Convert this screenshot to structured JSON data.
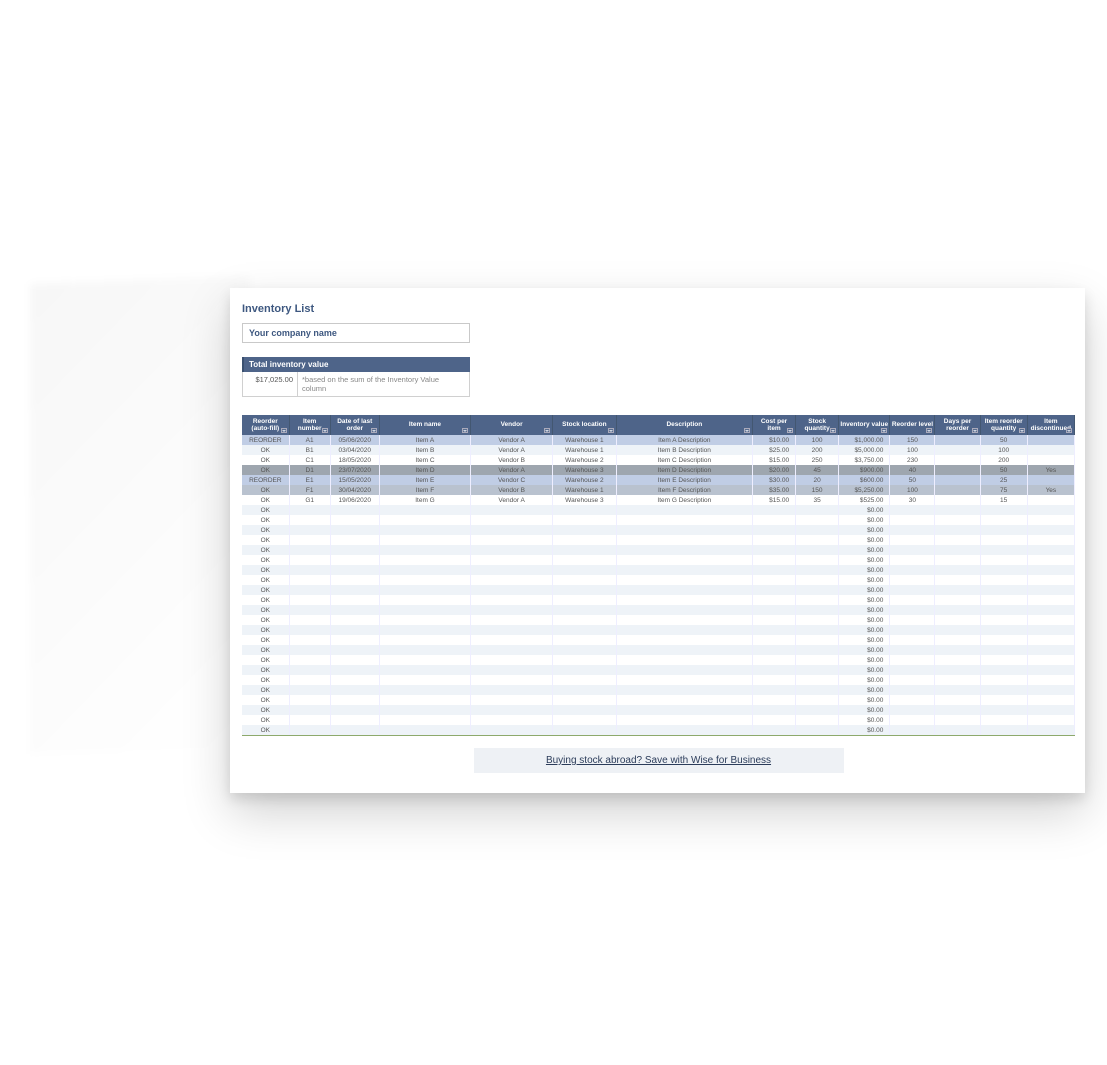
{
  "title": "Inventory List",
  "company_placeholder": "Your company name",
  "tiv_label": "Total inventory value",
  "tiv_value": "$17,025.00",
  "tiv_note": "*based on the sum of the Inventory Value column",
  "headers": {
    "reorder": "Reorder (auto-fill)",
    "item_number": "Item number",
    "date": "Date of last order",
    "name": "Item name",
    "vendor": "Vendor",
    "location": "Stock location",
    "description": "Description",
    "cost": "Cost per item",
    "qty": "Stock quantity",
    "value": "Inventory value",
    "level": "Reorder level",
    "days": "Days per reorder",
    "rqty": "Item reorder quantity",
    "disc": "Item discontinued"
  },
  "rows": [
    {
      "status": "REORDER",
      "item": "A1",
      "date": "05/06/2020",
      "name": "Item A",
      "vendor": "Vendor A",
      "loc": "Warehouse 1",
      "desc": "Item A Description",
      "cost": "$10.00",
      "qty": "100",
      "value": "$1,000.00",
      "level": "150",
      "days": "",
      "rqty": "50",
      "disc": "",
      "cls": "r-reorder"
    },
    {
      "status": "OK",
      "item": "B1",
      "date": "03/04/2020",
      "name": "Item B",
      "vendor": "Vendor A",
      "loc": "Warehouse 1",
      "desc": "Item B Description",
      "cost": "$25.00",
      "qty": "200",
      "value": "$5,000.00",
      "level": "100",
      "days": "",
      "rqty": "100",
      "disc": "",
      "cls": "r-normal"
    },
    {
      "status": "OK",
      "item": "C1",
      "date": "18/05/2020",
      "name": "Item C",
      "vendor": "Vendor B",
      "loc": "Warehouse 2",
      "desc": "Item C Description",
      "cost": "$15.00",
      "qty": "250",
      "value": "$3,750.00",
      "level": "230",
      "days": "",
      "rqty": "200",
      "disc": "",
      "cls": "r-normal2"
    },
    {
      "status": "OK",
      "item": "D1",
      "date": "23/07/2020",
      "name": "Item D",
      "vendor": "Vendor A",
      "loc": "Warehouse 3",
      "desc": "Item D Description",
      "cost": "$20.00",
      "qty": "45",
      "value": "$900.00",
      "level": "40",
      "days": "",
      "rqty": "50",
      "disc": "Yes",
      "cls": "r-disc"
    },
    {
      "status": "REORDER",
      "item": "E1",
      "date": "15/05/2020",
      "name": "Item E",
      "vendor": "Vendor C",
      "loc": "Warehouse 2",
      "desc": "Item E Description",
      "cost": "$30.00",
      "qty": "20",
      "value": "$600.00",
      "level": "50",
      "days": "",
      "rqty": "25",
      "disc": "",
      "cls": "r-reorder"
    },
    {
      "status": "OK",
      "item": "F1",
      "date": "30/04/2020",
      "name": "Item F",
      "vendor": "Vendor B",
      "loc": "Warehouse 1",
      "desc": "Item F Description",
      "cost": "$35.00",
      "qty": "150",
      "value": "$5,250.00",
      "level": "100",
      "days": "",
      "rqty": "75",
      "disc": "Yes",
      "cls": "r-disc2"
    },
    {
      "status": "OK",
      "item": "G1",
      "date": "19/06/2020",
      "name": "Item G",
      "vendor": "Vendor A",
      "loc": "Warehouse 3",
      "desc": "Item G Description",
      "cost": "$15.00",
      "qty": "35",
      "value": "$525.00",
      "level": "30",
      "days": "",
      "rqty": "15",
      "disc": "",
      "cls": "r-normal2"
    },
    {
      "status": "OK",
      "item": "",
      "date": "",
      "name": "",
      "vendor": "",
      "loc": "",
      "desc": "",
      "cost": "",
      "qty": "",
      "value": "$0.00",
      "level": "",
      "days": "",
      "rqty": "",
      "disc": "",
      "cls": "r-normal"
    },
    {
      "status": "OK",
      "item": "",
      "date": "",
      "name": "",
      "vendor": "",
      "loc": "",
      "desc": "",
      "cost": "",
      "qty": "",
      "value": "$0.00",
      "level": "",
      "days": "",
      "rqty": "",
      "disc": "",
      "cls": "r-normal2"
    },
    {
      "status": "OK",
      "item": "",
      "date": "",
      "name": "",
      "vendor": "",
      "loc": "",
      "desc": "",
      "cost": "",
      "qty": "",
      "value": "$0.00",
      "level": "",
      "days": "",
      "rqty": "",
      "disc": "",
      "cls": "r-normal"
    },
    {
      "status": "OK",
      "item": "",
      "date": "",
      "name": "",
      "vendor": "",
      "loc": "",
      "desc": "",
      "cost": "",
      "qty": "",
      "value": "$0.00",
      "level": "",
      "days": "",
      "rqty": "",
      "disc": "",
      "cls": "r-normal2"
    },
    {
      "status": "OK",
      "item": "",
      "date": "",
      "name": "",
      "vendor": "",
      "loc": "",
      "desc": "",
      "cost": "",
      "qty": "",
      "value": "$0.00",
      "level": "",
      "days": "",
      "rqty": "",
      "disc": "",
      "cls": "r-normal"
    },
    {
      "status": "OK",
      "item": "",
      "date": "",
      "name": "",
      "vendor": "",
      "loc": "",
      "desc": "",
      "cost": "",
      "qty": "",
      "value": "$0.00",
      "level": "",
      "days": "",
      "rqty": "",
      "disc": "",
      "cls": "r-normal2"
    },
    {
      "status": "OK",
      "item": "",
      "date": "",
      "name": "",
      "vendor": "",
      "loc": "",
      "desc": "",
      "cost": "",
      "qty": "",
      "value": "$0.00",
      "level": "",
      "days": "",
      "rqty": "",
      "disc": "",
      "cls": "r-normal"
    },
    {
      "status": "OK",
      "item": "",
      "date": "",
      "name": "",
      "vendor": "",
      "loc": "",
      "desc": "",
      "cost": "",
      "qty": "",
      "value": "$0.00",
      "level": "",
      "days": "",
      "rqty": "",
      "disc": "",
      "cls": "r-normal2"
    },
    {
      "status": "OK",
      "item": "",
      "date": "",
      "name": "",
      "vendor": "",
      "loc": "",
      "desc": "",
      "cost": "",
      "qty": "",
      "value": "$0.00",
      "level": "",
      "days": "",
      "rqty": "",
      "disc": "",
      "cls": "r-normal"
    },
    {
      "status": "OK",
      "item": "",
      "date": "",
      "name": "",
      "vendor": "",
      "loc": "",
      "desc": "",
      "cost": "",
      "qty": "",
      "value": "$0.00",
      "level": "",
      "days": "",
      "rqty": "",
      "disc": "",
      "cls": "r-normal2"
    },
    {
      "status": "OK",
      "item": "",
      "date": "",
      "name": "",
      "vendor": "",
      "loc": "",
      "desc": "",
      "cost": "",
      "qty": "",
      "value": "$0.00",
      "level": "",
      "days": "",
      "rqty": "",
      "disc": "",
      "cls": "r-normal"
    },
    {
      "status": "OK",
      "item": "",
      "date": "",
      "name": "",
      "vendor": "",
      "loc": "",
      "desc": "",
      "cost": "",
      "qty": "",
      "value": "$0.00",
      "level": "",
      "days": "",
      "rqty": "",
      "disc": "",
      "cls": "r-normal2"
    },
    {
      "status": "OK",
      "item": "",
      "date": "",
      "name": "",
      "vendor": "",
      "loc": "",
      "desc": "",
      "cost": "",
      "qty": "",
      "value": "$0.00",
      "level": "",
      "days": "",
      "rqty": "",
      "disc": "",
      "cls": "r-normal"
    },
    {
      "status": "OK",
      "item": "",
      "date": "",
      "name": "",
      "vendor": "",
      "loc": "",
      "desc": "",
      "cost": "",
      "qty": "",
      "value": "$0.00",
      "level": "",
      "days": "",
      "rqty": "",
      "disc": "",
      "cls": "r-normal2"
    },
    {
      "status": "OK",
      "item": "",
      "date": "",
      "name": "",
      "vendor": "",
      "loc": "",
      "desc": "",
      "cost": "",
      "qty": "",
      "value": "$0.00",
      "level": "",
      "days": "",
      "rqty": "",
      "disc": "",
      "cls": "r-normal"
    },
    {
      "status": "OK",
      "item": "",
      "date": "",
      "name": "",
      "vendor": "",
      "loc": "",
      "desc": "",
      "cost": "",
      "qty": "",
      "value": "$0.00",
      "level": "",
      "days": "",
      "rqty": "",
      "disc": "",
      "cls": "r-normal2"
    },
    {
      "status": "OK",
      "item": "",
      "date": "",
      "name": "",
      "vendor": "",
      "loc": "",
      "desc": "",
      "cost": "",
      "qty": "",
      "value": "$0.00",
      "level": "",
      "days": "",
      "rqty": "",
      "disc": "",
      "cls": "r-normal"
    },
    {
      "status": "OK",
      "item": "",
      "date": "",
      "name": "",
      "vendor": "",
      "loc": "",
      "desc": "",
      "cost": "",
      "qty": "",
      "value": "$0.00",
      "level": "",
      "days": "",
      "rqty": "",
      "disc": "",
      "cls": "r-normal2"
    },
    {
      "status": "OK",
      "item": "",
      "date": "",
      "name": "",
      "vendor": "",
      "loc": "",
      "desc": "",
      "cost": "",
      "qty": "",
      "value": "$0.00",
      "level": "",
      "days": "",
      "rqty": "",
      "disc": "",
      "cls": "r-normal"
    },
    {
      "status": "OK",
      "item": "",
      "date": "",
      "name": "",
      "vendor": "",
      "loc": "",
      "desc": "",
      "cost": "",
      "qty": "",
      "value": "$0.00",
      "level": "",
      "days": "",
      "rqty": "",
      "disc": "",
      "cls": "r-normal2"
    },
    {
      "status": "OK",
      "item": "",
      "date": "",
      "name": "",
      "vendor": "",
      "loc": "",
      "desc": "",
      "cost": "",
      "qty": "",
      "value": "$0.00",
      "level": "",
      "days": "",
      "rqty": "",
      "disc": "",
      "cls": "r-normal"
    },
    {
      "status": "OK",
      "item": "",
      "date": "",
      "name": "",
      "vendor": "",
      "loc": "",
      "desc": "",
      "cost": "",
      "qty": "",
      "value": "$0.00",
      "level": "",
      "days": "",
      "rqty": "",
      "disc": "",
      "cls": "r-normal2"
    },
    {
      "status": "OK",
      "item": "",
      "date": "",
      "name": "",
      "vendor": "",
      "loc": "",
      "desc": "",
      "cost": "",
      "qty": "",
      "value": "$0.00",
      "level": "",
      "days": "",
      "rqty": "",
      "disc": "",
      "cls": "r-normal"
    }
  ],
  "promo": "Buying stock abroad? Save with Wise for Business"
}
